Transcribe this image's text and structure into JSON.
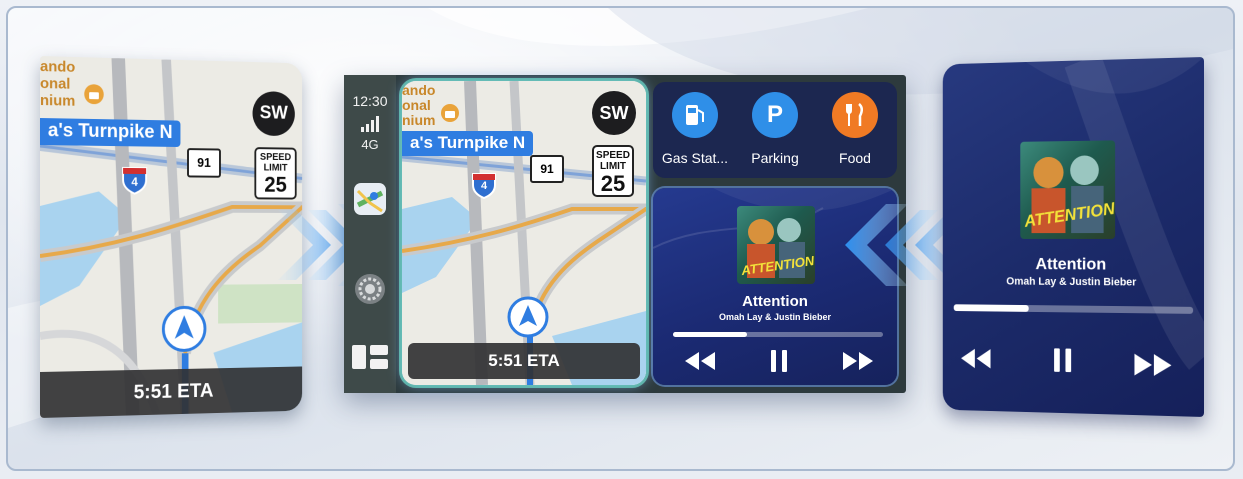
{
  "left_map": {
    "street": "a's Turnpike N",
    "poi_lines": [
      "ando",
      "onal",
      "nium"
    ],
    "route_shield": "91",
    "interstate": "4",
    "speed_limit": {
      "label1": "SPEED",
      "label2": "LIMIT",
      "value": "25"
    },
    "compass": "SW",
    "eta": "5:51 ETA"
  },
  "center": {
    "status": {
      "time": "12:30",
      "network": "4G"
    },
    "map": {
      "street": "a's Turnpike N",
      "poi_lines": [
        "ando",
        "onal",
        "nium"
      ],
      "route_shield": "91",
      "interstate": "4",
      "speed_limit": {
        "label1": "SPEED",
        "label2": "LIMIT",
        "value": "25"
      },
      "compass": "SW",
      "eta": "5:51 ETA"
    },
    "poi_buttons": [
      {
        "label": "Gas Stat...",
        "icon": "gas-pump-icon",
        "color": "#2f8fe8"
      },
      {
        "label": "Parking",
        "icon": "parking-icon",
        "color": "#2f8fe8"
      },
      {
        "label": "Food",
        "icon": "fork-knife-icon",
        "color": "#f07a24"
      }
    ],
    "now_playing": {
      "album_art_text": "ATTENTION",
      "title": "Attention",
      "artist": "Omah Lay & Justin Bieber",
      "progress": 0.35
    }
  },
  "right_player": {
    "album_art_text": "ATTENTION",
    "title": "Attention",
    "artist": "Omah Lay & Justin Bieber",
    "progress": 0.32
  },
  "colors": {
    "route_blue": "#2f7de1",
    "player_bg": "#1c2b6a",
    "gas_blue": "#2f8fe8",
    "food_orange": "#f07a24"
  }
}
